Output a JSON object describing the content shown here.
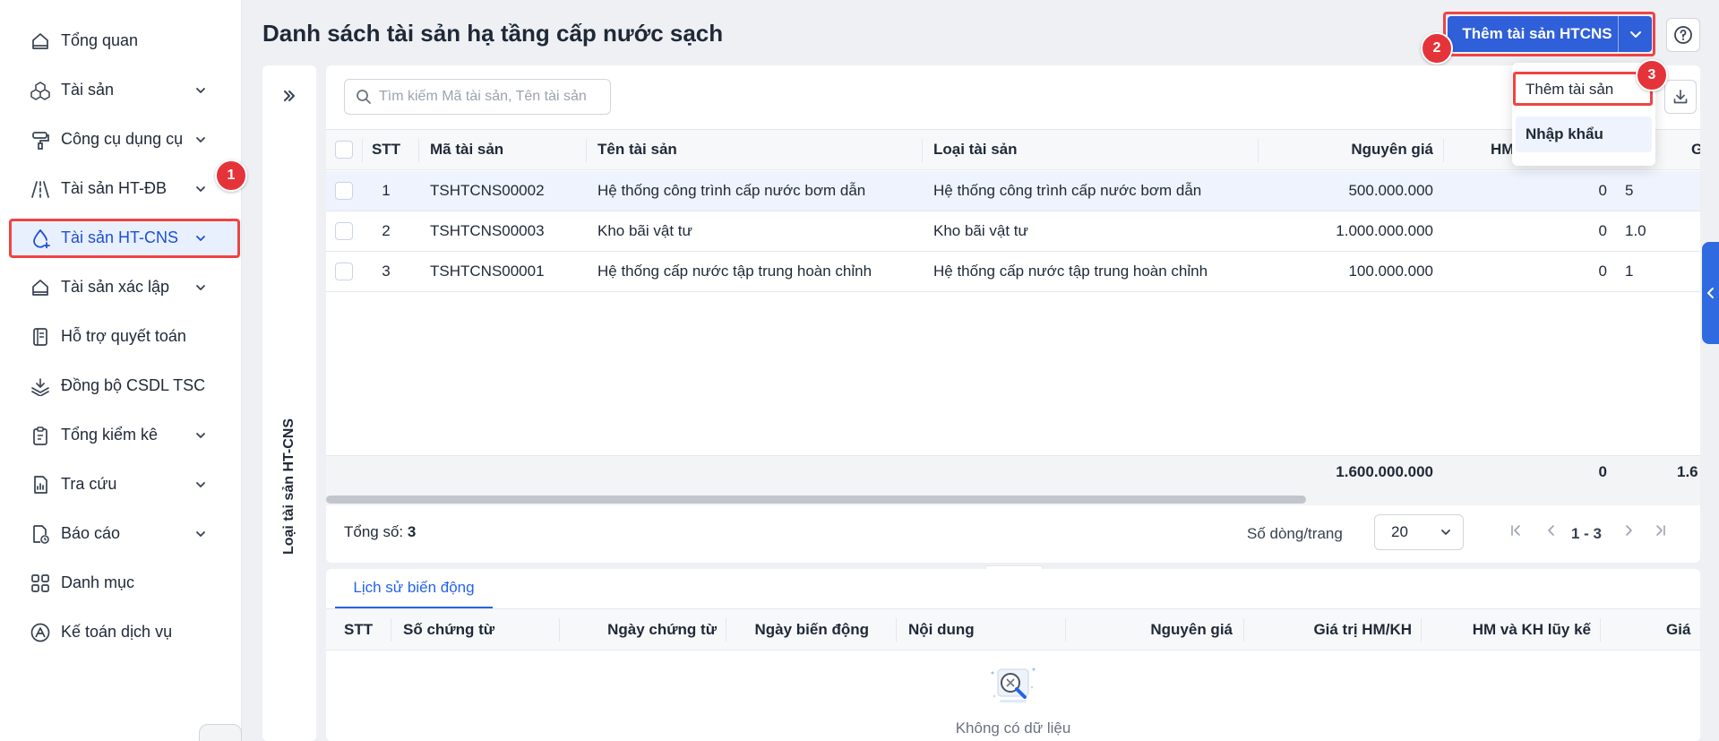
{
  "sidebar": {
    "items": [
      {
        "label": "Tổng quan",
        "icon": "home-icon",
        "has_chevron": false
      },
      {
        "label": "Tài sản",
        "icon": "boxes-icon",
        "has_chevron": true
      },
      {
        "label": "Công cụ dụng cụ",
        "icon": "paint-roller-icon",
        "has_chevron": true
      },
      {
        "label": "Tài sản HT-ĐB",
        "icon": "road-icon",
        "has_chevron": true
      },
      {
        "label": "Tài sản HT-CNS",
        "icon": "water-drop-icon",
        "has_chevron": true,
        "active": true
      },
      {
        "label": "Tài sản xác lập",
        "icon": "home-icon",
        "has_chevron": true
      },
      {
        "label": "Hỗ trợ quyết toán",
        "icon": "book-icon",
        "has_chevron": false
      },
      {
        "label": "Đồng bộ CSDL TSC",
        "icon": "layers-icon",
        "has_chevron": false
      },
      {
        "label": "Tổng kiểm kê",
        "icon": "clipboard-icon",
        "has_chevron": true
      },
      {
        "label": "Tra cứu",
        "icon": "file-chart-icon",
        "has_chevron": true
      },
      {
        "label": "Báo cáo",
        "icon": "report-icon",
        "has_chevron": true
      },
      {
        "label": "Danh mục",
        "icon": "grid-icon",
        "has_chevron": false
      },
      {
        "label": "Kế toán dịch vụ",
        "icon": "logo-icon",
        "has_chevron": false
      }
    ]
  },
  "header": {
    "title": "Danh sách tài sản hạ tầng cấp nước sạch",
    "add_button": "Thêm tài sản HTCNS"
  },
  "badges": {
    "b1": "1",
    "b2": "2",
    "b3": "3"
  },
  "menu": {
    "add_asset": "Thêm tài sản",
    "import": "Nhập khẩu"
  },
  "type_panel": {
    "label": "Loại tài sản HT-CNS"
  },
  "search": {
    "placeholder": "Tìm kiếm Mã tài sản, Tên tài sản"
  },
  "table": {
    "columns": {
      "stt": "STT",
      "ma": "Mã tài sản",
      "ten": "Tên tài sản",
      "loai": "Loại tài sản",
      "nguyen_gia": "Nguyên giá",
      "hm": "HM",
      "g": "G"
    },
    "rows": [
      {
        "stt": "1",
        "ma": "TSHTCNS00002",
        "ten": "Hệ thống công trình cấp nước bơm dẫn",
        "loai": "Hệ thống công trình cấp nước bơm dẫn",
        "nguyen_gia": "500.000.000",
        "hm": "0",
        "g": "5"
      },
      {
        "stt": "2",
        "ma": "TSHTCNS00003",
        "ten": "Kho bãi vật tư",
        "loai": "Kho bãi vật tư",
        "nguyen_gia": "1.000.000.000",
        "hm": "0",
        "g": "1.0"
      },
      {
        "stt": "3",
        "ma": "TSHTCNS00001",
        "ten": "Hệ thống cấp nước tập trung hoàn chỉnh",
        "loai": "Hệ thống cấp nước tập trung hoàn chỉnh",
        "nguyen_gia": "100.000.000",
        "hm": "0",
        "g": "1"
      }
    ],
    "totals": {
      "nguyen_gia": "1.600.000.000",
      "hm": "0",
      "g": "1.6"
    }
  },
  "footer": {
    "total_label": "Tổng số:",
    "total_value": "3",
    "rows_per_page_label": "Số dòng/trang",
    "rows_per_page": "20",
    "range": "1 - 3"
  },
  "history": {
    "tab": "Lịch sử biến động",
    "columns": {
      "stt": "STT",
      "so_ct": "Số chứng từ",
      "ngay_ct": "Ngày chứng từ",
      "ngay_bd": "Ngày biến động",
      "noi_dung": "Nội dung",
      "nguyen_gia": "Nguyên giá",
      "gt_hm": "Giá trị HM/KH",
      "hm_kh": "HM và KH lũy kế",
      "gia": "Giá"
    },
    "empty_text": "Không có dữ liệu"
  },
  "colors": {
    "accent": "#2f5fd9",
    "highlight": "#ef4444",
    "badge": "#e4343a"
  }
}
